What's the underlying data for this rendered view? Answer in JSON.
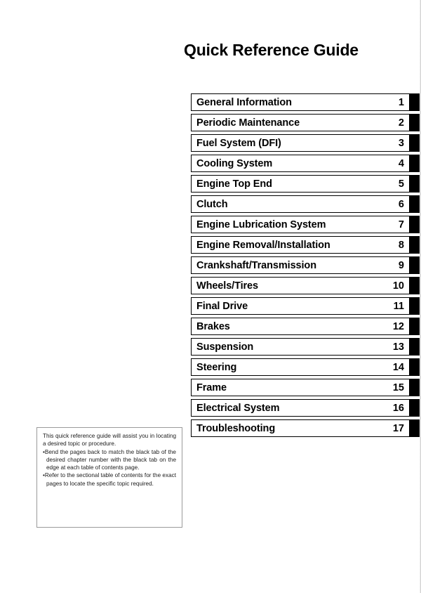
{
  "page": {
    "title": "Quick Reference Guide"
  },
  "chapters": [
    {
      "label": "General Information",
      "number": "1"
    },
    {
      "label": "Periodic Maintenance",
      "number": "2"
    },
    {
      "label": "Fuel System (DFI)",
      "number": "3"
    },
    {
      "label": "Cooling System",
      "number": "4"
    },
    {
      "label": "Engine Top End",
      "number": "5"
    },
    {
      "label": "Clutch",
      "number": "6"
    },
    {
      "label": "Engine Lubrication System",
      "number": "7"
    },
    {
      "label": "Engine Removal/Installation",
      "number": "8"
    },
    {
      "label": "Crankshaft/Transmission",
      "number": "9"
    },
    {
      "label": "Wheels/Tires",
      "number": "10"
    },
    {
      "label": "Final Drive",
      "number": "11"
    },
    {
      "label": "Brakes",
      "number": "12"
    },
    {
      "label": "Suspension",
      "number": "13"
    },
    {
      "label": "Steering",
      "number": "14"
    },
    {
      "label": "Frame",
      "number": "15"
    },
    {
      "label": "Electrical System",
      "number": "16"
    },
    {
      "label": "Troubleshooting",
      "number": "17"
    }
  ],
  "note": {
    "intro": "This quick reference guide will assist you in locating a desired topic or procedure.",
    "bullet_mark": "•",
    "bullets": [
      "Bend the pages back to match the black tab of the desired chapter number with the black tab on the edge at each table of contents page.",
      "Refer to the sectional table of contents for the exact pages to locate the specific topic required."
    ]
  },
  "colors": {
    "tab_black": "#000000",
    "box_border": "#000000",
    "note_border": "#9a9a9a",
    "page_background": "#ffffff"
  }
}
